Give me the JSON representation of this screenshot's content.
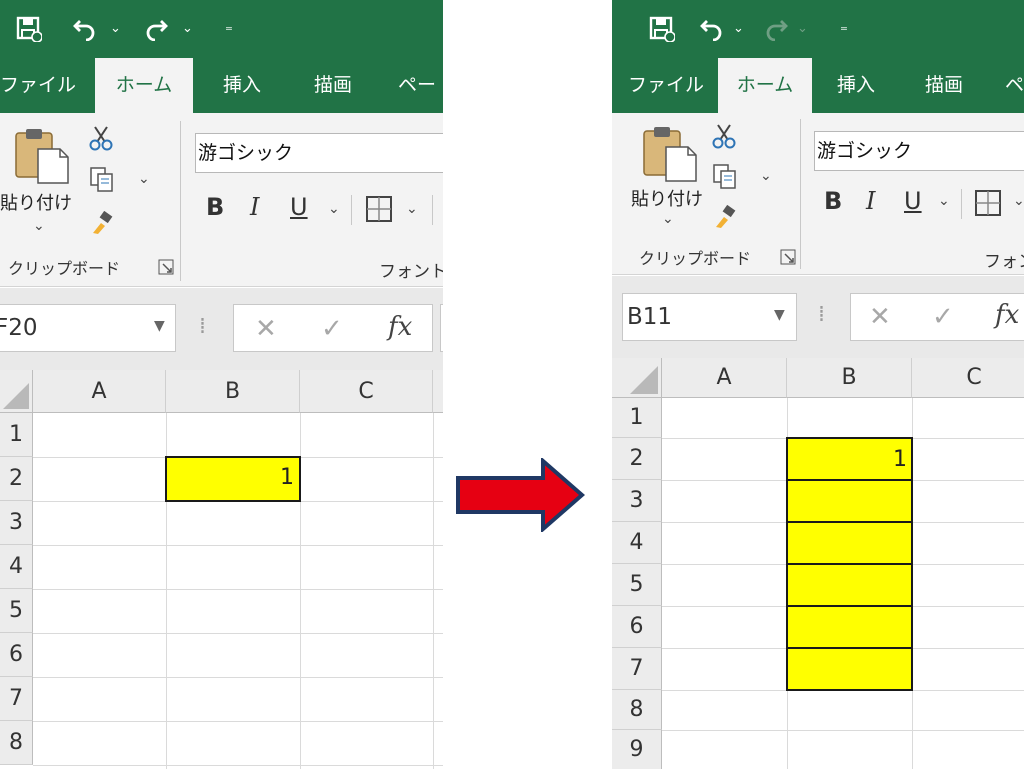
{
  "colors": {
    "excel_green": "#217346",
    "ribbon_bg": "#f3f3f3",
    "highlight": "#ffff00",
    "arrow_fill": "#e60012",
    "arrow_stroke": "#1f3864"
  },
  "quick_access": {
    "save_icon": "save-icon",
    "undo_icon": "undo-icon",
    "redo_icon": "redo-icon",
    "customize_icon": "customize-quick-access-icon"
  },
  "tabs": {
    "file": "ファイル",
    "home": "ホーム",
    "insert": "挿入",
    "draw": "描画",
    "page_left": "ペー",
    "page_right": "ペ"
  },
  "ribbon": {
    "paste_label": "貼り付け",
    "clipboard_group": "クリップボード",
    "font_group_left": "フォント",
    "font_group_right": "フォン",
    "font_name": "游ゴシック",
    "bold": "B",
    "italic": "I",
    "underline": "U"
  },
  "formula_bar": {
    "fx": "fx"
  },
  "left": {
    "name_box": "F20",
    "columns": [
      "A",
      "B",
      "C"
    ],
    "rows": [
      "1",
      "2",
      "3",
      "4",
      "5",
      "6",
      "7",
      "8"
    ],
    "cell_b2": "1"
  },
  "right": {
    "name_box": "B11",
    "columns": [
      "A",
      "B",
      "C"
    ],
    "rows": [
      "1",
      "2",
      "3",
      "4",
      "5",
      "6",
      "7",
      "8",
      "9"
    ],
    "cell_b2": "1"
  }
}
